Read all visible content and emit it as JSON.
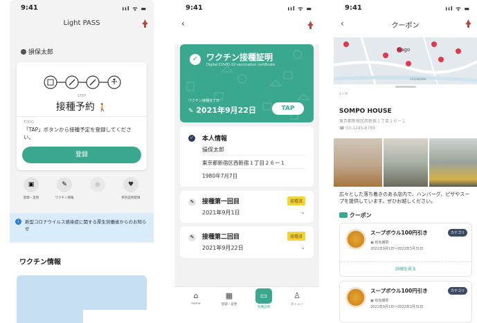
{
  "status": {
    "time": "9:41",
    "icons": "ııl ᯤ ▬"
  },
  "screen1": {
    "title": "Light PASS",
    "user": "損保太郎",
    "step_caption": "STEP",
    "step_label": "接種予約",
    "todo_caption": "TODO",
    "todo_text": "「TAP」ボタンから接種予定を登録してください。",
    "register_button": "登録",
    "quick_actions": [
      "登録・変更",
      "ワクチン情報",
      "",
      "県別証明登録"
    ],
    "notice": "新型コロナウイルス感染症に関する厚生労働省からのお知らせ",
    "section_title": "ワクチン情報"
  },
  "screen2": {
    "cert_title": "ワクチン接種証明",
    "cert_subtitle": "Digital COVID-19 vaccination certificate",
    "cert_caption": "ワクチン接種完了日",
    "cert_date": "2021年9月22日",
    "tap_button": "TAP",
    "personal": {
      "heading": "本人情報",
      "name": "損保太郎",
      "address": "東京都新宿区西新宿１丁目２６ー１",
      "birth": "1980年7月7日"
    },
    "doses": [
      {
        "title": "接種第一回目",
        "date": "2021年9月1日",
        "badge": "接種済"
      },
      {
        "title": "接種第二回目",
        "date": "2021年9月22日",
        "badge": "接種済"
      }
    ],
    "tabs": [
      "Home",
      "登録・変更",
      "各種証明",
      "メニュー"
    ]
  },
  "screen3": {
    "title": "クーポン",
    "map_label": "Nago",
    "map_road": "ASSHIKAWA",
    "distance": "1 l m",
    "shop_name": "SOMPO HOUSE",
    "shop_address": "東京都新宿区西新宿１丁目２６ー１",
    "shop_phone": "03-1245-6789",
    "description": "広々とした落ち着きのある店内で、ハンバーグ、ピザやスープを提供しています。ぜひお越しください。",
    "coupon_heading": "クーポン",
    "coupons": [
      {
        "title": "スープボウル100円引き",
        "tag": "カテゴリ",
        "period_label": "有効期限",
        "period": "2021年9月1日〜2022年3月31日",
        "detail": "詳細を見る"
      },
      {
        "title": "スープボウル100円引き",
        "tag": "カテゴリ",
        "period_label": "有効期限",
        "period": "2021年9月1日〜2022年3月31日"
      }
    ]
  },
  "colors": {
    "accent": "#3aa88f",
    "badge": "#f3d33a",
    "notice_bg": "#d9ecfa"
  }
}
